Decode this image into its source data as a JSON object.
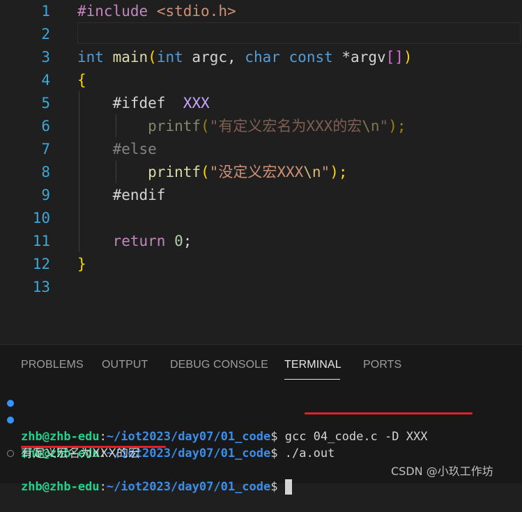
{
  "editor": {
    "line_numbers": [
      "1",
      "2",
      "3",
      "4",
      "5",
      "6",
      "7",
      "8",
      "9",
      "10",
      "11",
      "12",
      "13"
    ],
    "code": {
      "l1_directive": "#include",
      "l1_header": "<stdio.h>",
      "l3_int": "int",
      "l3_main": "main",
      "l3_open": "(",
      "l3_int2": "int",
      "l3_argc": "argc,",
      "l3_char": "char",
      "l3_const": "const",
      "l3_star_argv": "*argv",
      "l3_brackets": "[]",
      "l3_close": ")",
      "l4_brace": "{",
      "l5_ifdef": "#ifdef",
      "l5_macro": "XXX",
      "l6_printf": "printf",
      "l6_open": "(",
      "l6_str": "\"有定义宏名为XXX的宏",
      "l6_esc": "\\n",
      "l6_strend": "\"",
      "l6_close": ");",
      "l7_else": "#else",
      "l8_printf": "printf",
      "l8_open": "(",
      "l8_str": "\"没定义宏XXX",
      "l8_esc": "\\n",
      "l8_strend": "\"",
      "l8_close": ");",
      "l9_endif": "#endif",
      "l11_return": "return",
      "l11_zero": "0",
      "l11_semi": ";",
      "l12_brace": "}"
    }
  },
  "panel": {
    "tabs": [
      {
        "label": "PROBLEMS"
      },
      {
        "label": "OUTPUT"
      },
      {
        "label": "DEBUG CONSOLE"
      },
      {
        "label": "TERMINAL"
      },
      {
        "label": "PORTS"
      }
    ],
    "active_tab": "TERMINAL"
  },
  "terminal": {
    "user_host": "zhb@zhb-edu",
    "colon": ":",
    "cwd": "~/iot2023/day07/01_code",
    "prompt": "$",
    "lines": [
      {
        "command": " gcc 04_code.c -D XXX"
      },
      {
        "command": " ./a.out"
      },
      {
        "output": "有定义宏名为XXX的宏"
      },
      {
        "command": " "
      }
    ]
  },
  "watermark": "CSDN @小玖工作坊",
  "colors": {
    "editor_bg": "#1f1f1f",
    "panel_bg": "#181818",
    "annotation_red": "#e0202a",
    "line_number": "#3ea7d8"
  }
}
